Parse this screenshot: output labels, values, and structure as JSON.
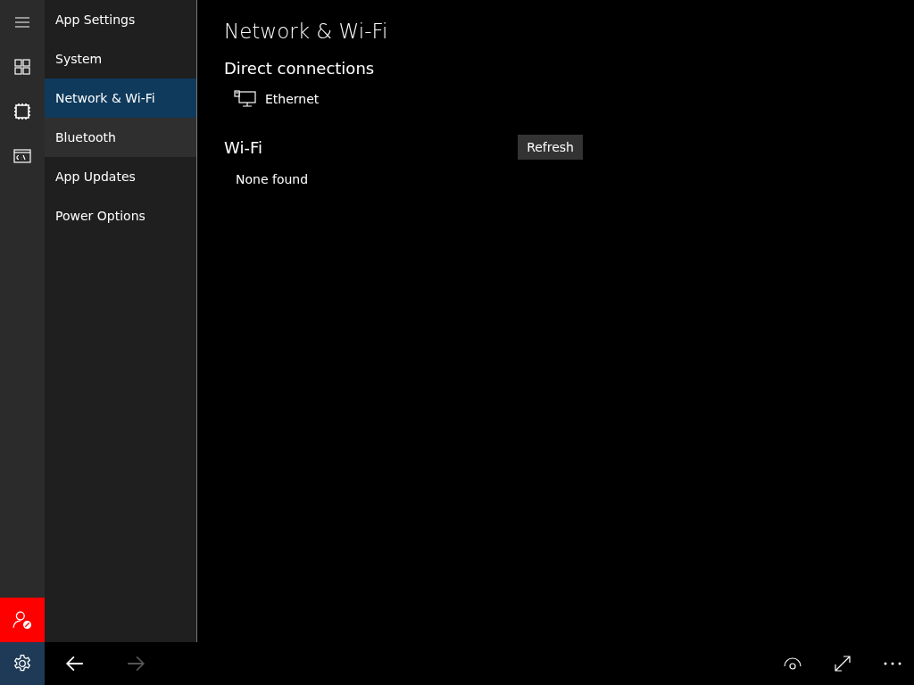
{
  "sidebar": {
    "items": [
      {
        "label": "App Settings",
        "selected": false,
        "hovered": false
      },
      {
        "label": "System",
        "selected": false,
        "hovered": false
      },
      {
        "label": "Network & Wi-Fi",
        "selected": true,
        "hovered": false
      },
      {
        "label": "Bluetooth",
        "selected": false,
        "hovered": true
      },
      {
        "label": "App Updates",
        "selected": false,
        "hovered": false
      },
      {
        "label": "Power Options",
        "selected": false,
        "hovered": false
      }
    ]
  },
  "page": {
    "title": "Network & Wi-Fi",
    "direct_connections": {
      "heading": "Direct connections",
      "items": [
        {
          "label": "Ethernet"
        }
      ]
    },
    "wifi": {
      "heading": "Wi-Fi",
      "refresh_button": "Refresh",
      "empty_text": "None found"
    }
  },
  "navigation": {
    "back_disabled": false,
    "forward_disabled": true
  }
}
